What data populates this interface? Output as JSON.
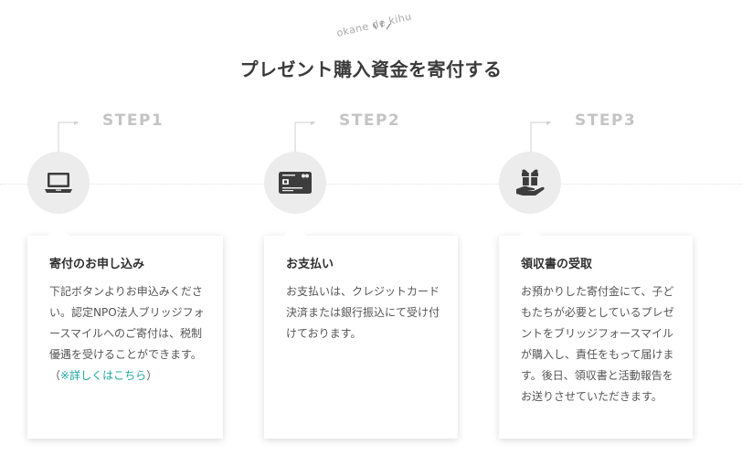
{
  "header": {
    "tagline": "okane de kihu",
    "title": "プレゼント購入資金を寄付する"
  },
  "steps": [
    {
      "label": "STEP1",
      "icon": "laptop-icon",
      "card_title": "寄付のお申し込み",
      "card_body": "下記ボタンよりお申込みください。認定NPO法人ブリッジフォースマイルへのご寄付は、税制優遇を受けることができます。（",
      "link_text": "※詳しくはこちら",
      "body_suffix": "）"
    },
    {
      "label": "STEP2",
      "icon": "credit-card-icon",
      "card_title": "お支払い",
      "card_body": "お支払いは、クレジットカード決済または銀行振込にて受け付けております。"
    },
    {
      "label": "STEP3",
      "icon": "gift-hand-icon",
      "card_title": "領収書の受取",
      "card_body": "お預かりした寄付金にて、子どもたちが必要としているプレゼントをブリッジフォースマイルが購入し、責任をもって届けます。後日、領収書と活動報告をお送りさせていただきます。"
    }
  ],
  "colors": {
    "step_label": "#c4c4c4",
    "circle_bg": "#ececec",
    "icon": "#3d3d3d",
    "link": "#1fa7a0"
  }
}
